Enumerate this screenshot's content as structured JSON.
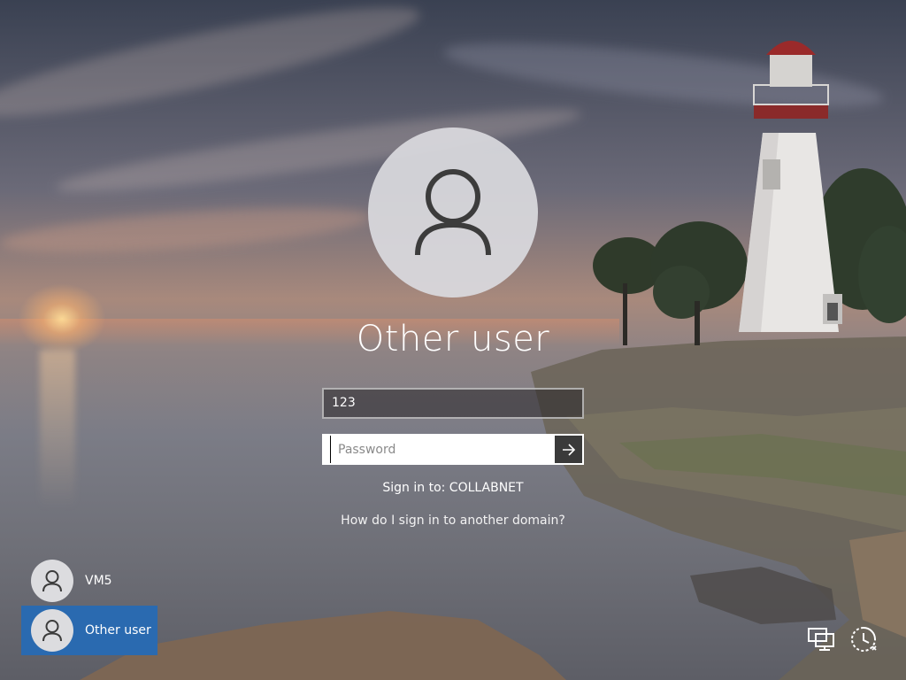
{
  "login": {
    "user_name": "Other user",
    "username_value": "123",
    "password_placeholder": "Password",
    "sign_in_to": "Sign in to: COLLABNET",
    "domain_help_link": "How do I sign in to another domain?"
  },
  "user_list": [
    {
      "name": "VM5",
      "selected": false
    },
    {
      "name": "Other user",
      "selected": true
    }
  ],
  "icons": {
    "avatar": "person-icon",
    "submit": "arrow-right-icon",
    "network": "network-icon",
    "ease_of_access": "ease-of-access-icon"
  },
  "colors": {
    "selected_tile": "#2a6ab0",
    "submit_button": "#3a3a3a",
    "avatar_bg": "#dcdcdf"
  }
}
